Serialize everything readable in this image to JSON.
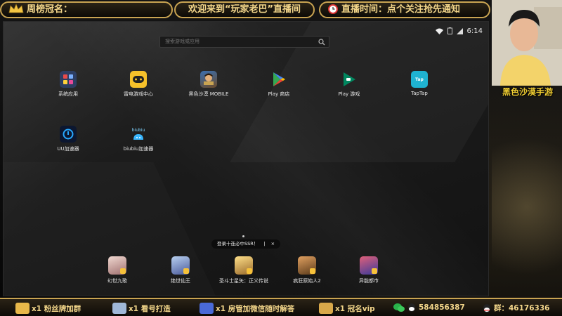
{
  "overlay": {
    "top_left": "周榜冠名：",
    "top_center": "欢迎来到“玩家老巴”直播间",
    "top_right": "直播时间：点个关注抢先通知",
    "stream_title": "黑色沙漠手游"
  },
  "status_bar": {
    "time": "6:14"
  },
  "search": {
    "placeholder": "搜索游戏或应用"
  },
  "apps": [
    {
      "label": "系统应用",
      "icon": "system-apps-icon",
      "color": "#2d3e63"
    },
    {
      "label": "雷电游戏中心",
      "icon": "ldplayer-gamepad-icon",
      "color": "#f6c12a"
    },
    {
      "label": "黑色沙漠 MOBILE",
      "icon": "black-desert-icon",
      "color": "#6a4a2a"
    },
    {
      "label": "Play 商店",
      "icon": "play-store-icon",
      "color": "transparent"
    },
    {
      "label": "Play 游戏",
      "icon": "play-games-icon",
      "color": "transparent"
    },
    {
      "label": "TapTap",
      "icon": "taptap-icon",
      "color": "#1fb3d1"
    },
    {
      "label": "UU加速器",
      "icon": "uu-accelerator-icon",
      "color": "#0c1730"
    },
    {
      "label": "biubiu加速器",
      "icon": "biubiu-icon",
      "color": "transparent",
      "icon_text": "biubiu"
    }
  ],
  "toast": {
    "text": "登录十连必中SSR！",
    "separator": "|",
    "close": "×"
  },
  "dock": [
    {
      "label": "幻世九歌",
      "color": "#c9a7a0"
    },
    {
      "label": "绝世仙王",
      "color": "#7a93c9"
    },
    {
      "label": "圣斗士星矢：正义传说",
      "color": "#d4a24a"
    },
    {
      "label": "疯狂原始人2",
      "color": "#8a5a3a"
    },
    {
      "label": "异能都市",
      "color": "#6a5acd"
    }
  ],
  "ticker": [
    {
      "label": "x1 粉丝牌加群",
      "color": "#e8b84a"
    },
    {
      "label": "x1 看号打造",
      "color": "#a0b8d8"
    },
    {
      "label": "x1 房管加微信随时解答",
      "color": "#4a6ad8"
    },
    {
      "label": "x1 冠名vip",
      "color": "#d8a84a"
    },
    {
      "label": "584856387",
      "color": "#29b34a"
    },
    {
      "label": "群：46176336",
      "color": "#e84a4a"
    }
  ]
}
